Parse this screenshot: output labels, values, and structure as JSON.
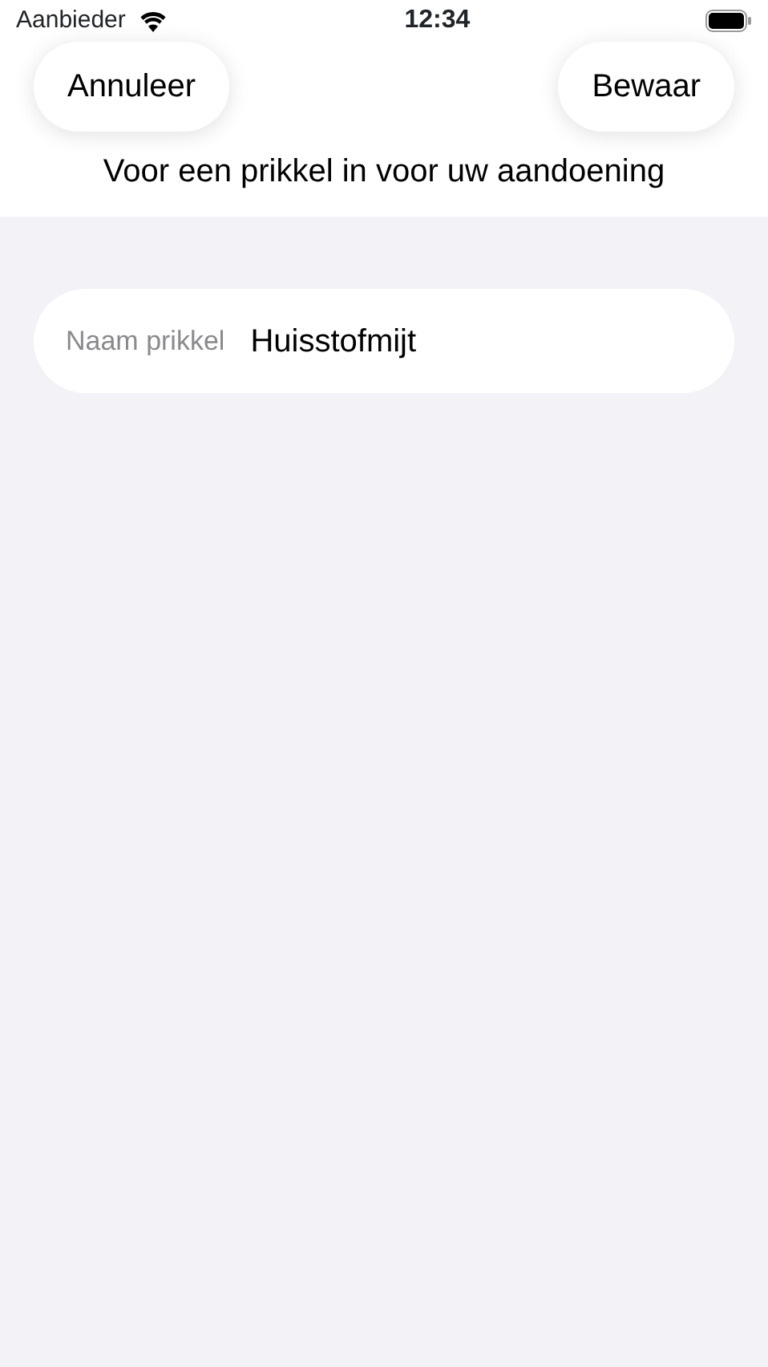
{
  "status_bar": {
    "carrier": "Aanbieder",
    "time": "12:34"
  },
  "nav": {
    "cancel": "Annuleer",
    "save": "Bewaar",
    "subtitle": "Voor een prikkel in voor uw aandoening"
  },
  "form": {
    "label": "Naam prikkel",
    "value": "Huisstofmijt"
  }
}
